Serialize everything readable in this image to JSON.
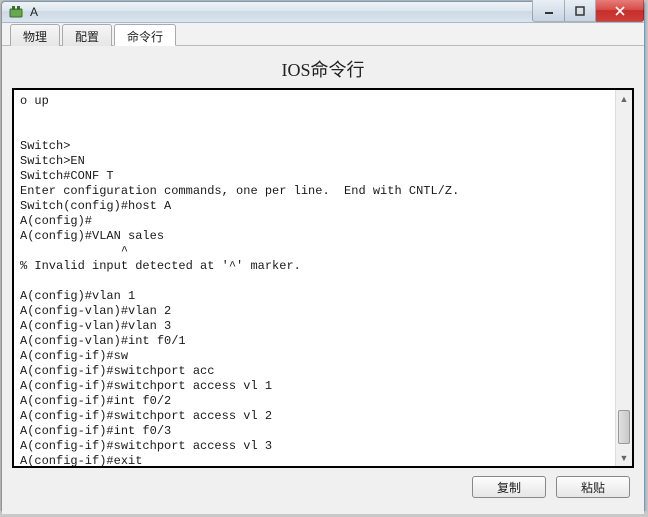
{
  "window": {
    "title": "A"
  },
  "tabs": {
    "t0": "物理",
    "t1": "配置",
    "t2": "命令行"
  },
  "panel_title": "IOS命令行",
  "terminal_text": "o up\n\n\nSwitch>\nSwitch>EN\nSwitch#CONF T\nEnter configuration commands, one per line.  End with CNTL/Z.\nSwitch(config)#host A\nA(config)#\nA(config)#VLAN sales\n              ^\n% Invalid input detected at '^' marker.\n\nA(config)#vlan 1\nA(config-vlan)#vlan 2\nA(config-vlan)#vlan 3\nA(config-vlan)#int f0/1\nA(config-if)#sw\nA(config-if)#switchport acc\nA(config-if)#switchport access vl 1\nA(config-if)#int f0/2\nA(config-if)#switchport access vl 2\nA(config-if)#int f0/3\nA(config-if)#switchport access vl 3\nA(config-if)#exit\nA(config)#sh ip route",
  "buttons": {
    "copy": "复制",
    "paste": "粘贴"
  }
}
